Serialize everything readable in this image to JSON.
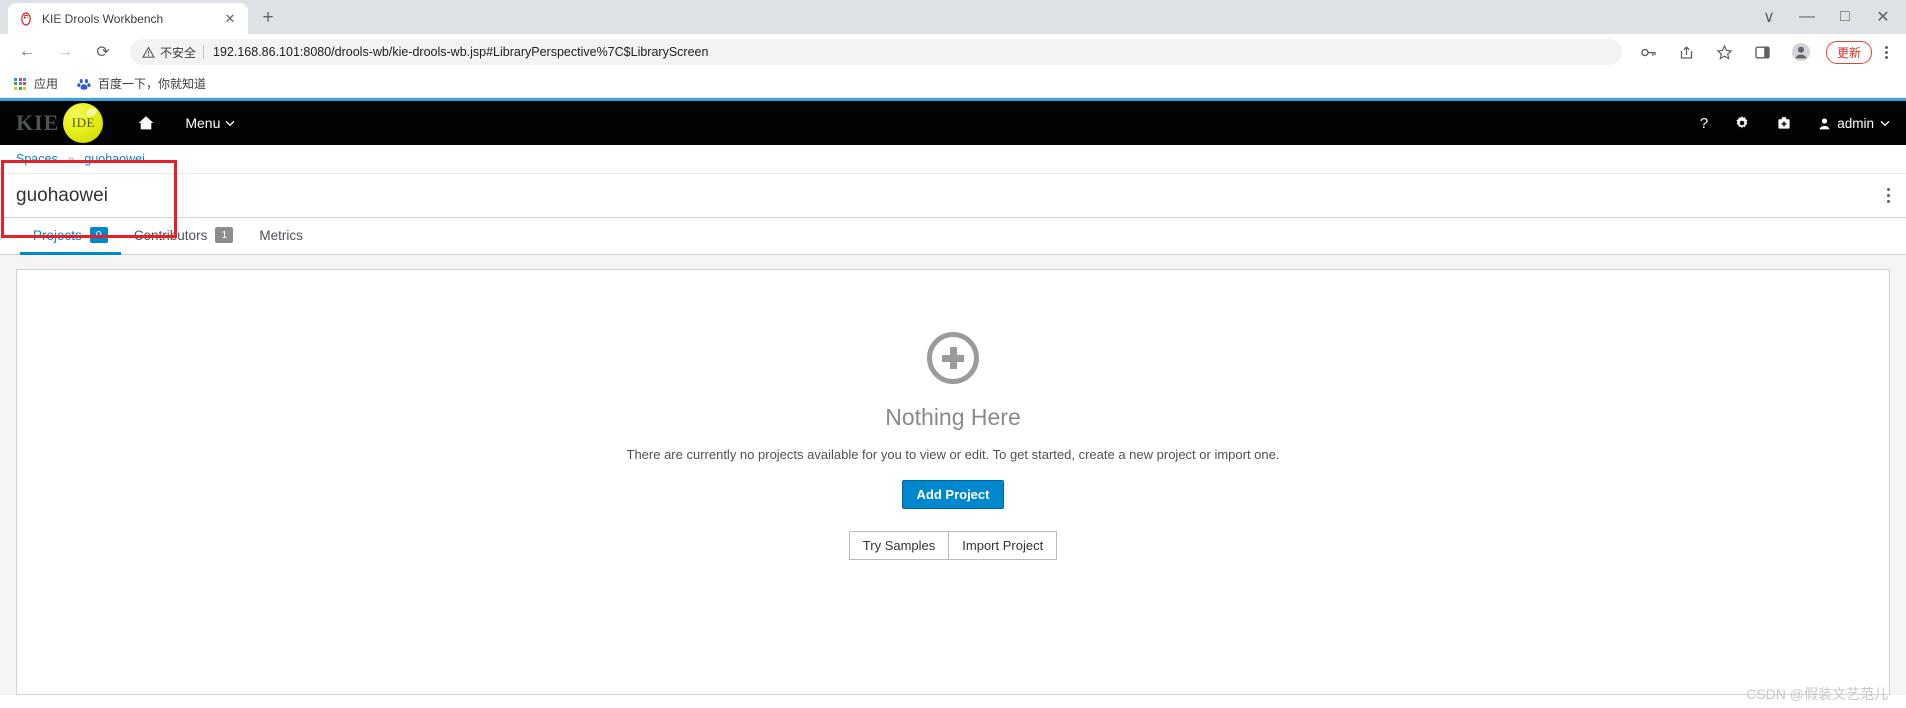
{
  "browser": {
    "tab": {
      "title": "KIE Drools Workbench",
      "favicon": "drools-dove-favicon",
      "close_label": "✕"
    },
    "new_tab_label": "+",
    "nav": {
      "back": "←",
      "forward": "→",
      "reload": "⟳"
    },
    "omnibox": {
      "warning_icon": "not-secure-warning-icon",
      "warning_text": "不安全",
      "url": "192.168.86.101:8080/drools-wb/kie-drools-wb.jsp#LibraryPerspective%7C$LibraryScreen"
    },
    "toolbar_icons": [
      "password-key-icon",
      "share-icon",
      "bookmark-star-icon",
      "side-panel-icon",
      "profile-avatar-icon"
    ],
    "update_label": "更新",
    "menu_label": "browser-menu",
    "bookmarks": [
      {
        "label": "应用",
        "icon": "apps-grid-icon"
      },
      {
        "label": "百度一下，你就知道",
        "icon": "baidu-paw-icon"
      }
    ],
    "window_controls": {
      "minimize": "—",
      "maximize": "□",
      "close": "✕",
      "chevron": "∨"
    }
  },
  "app_header": {
    "brand": "KIE",
    "ball_text": "IDE",
    "home_icon": "home-icon",
    "menu_label": "Menu",
    "caret": "⌄",
    "icons": [
      {
        "name": "help-icon",
        "glyph": "?"
      },
      {
        "name": "settings-gear-icon",
        "glyph": "⚙"
      },
      {
        "name": "kit-briefcase-icon",
        "glyph": "⛑"
      }
    ],
    "user": {
      "icon": "user-avatar-icon",
      "name": "admin",
      "caret": "⌄"
    }
  },
  "breadcrumb": {
    "items": [
      "Spaces",
      "guohaowei"
    ],
    "separator": "»"
  },
  "space": {
    "title": "guohaowei",
    "kebab_label": "space-actions-menu"
  },
  "tabs": [
    {
      "label": "Projects",
      "badge": "0",
      "active": true
    },
    {
      "label": "Contributors",
      "badge": "1",
      "active": false
    },
    {
      "label": "Metrics",
      "badge": "",
      "active": false
    }
  ],
  "empty_state": {
    "icon": "plus-circle-icon",
    "title": "Nothing Here",
    "description": "There are currently no projects available for you to view or edit. To get started, create a new project or import one.",
    "primary_button": "Add Project",
    "secondary_buttons": [
      "Try Samples",
      "Import Project"
    ]
  },
  "watermark": "CSDN @假装文艺范儿",
  "colors": {
    "accent_blue": "#0088ce",
    "header_black": "#030303",
    "annotation_red": "#e81f24",
    "top_rule_blue": "#39a5dc",
    "badge_gray": "#8b8d8f",
    "ide_yellow": "#e7ef1e"
  }
}
